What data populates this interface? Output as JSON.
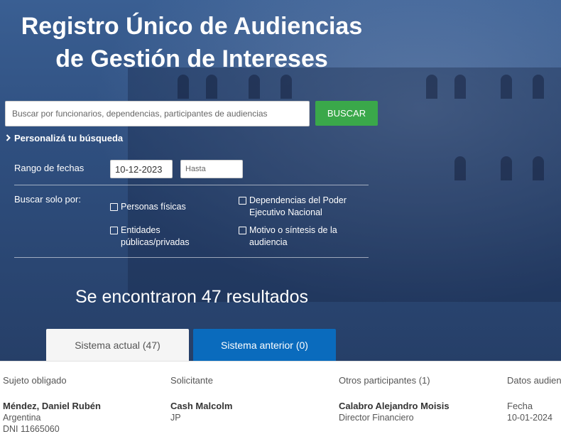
{
  "header": {
    "title_line1": "Registro Único de Audiencias",
    "title_line2": "de Gestión de Intereses"
  },
  "search": {
    "placeholder": "Buscar por funcionarios, dependencias, participantes de audiencias",
    "value": "",
    "button_label": "BUSCAR"
  },
  "filters": {
    "toggle_label": "Personalizá tu búsqueda",
    "date_range_label": "Rango de fechas",
    "date_from": "10-12-2023",
    "date_to_placeholder": "Hasta",
    "date_to": "",
    "search_only_label": "Buscar solo por:",
    "options": [
      {
        "label": "Personas físicas",
        "checked": false
      },
      {
        "label": "Entidades públicas/privadas",
        "line1": "Entidades",
        "line2": "públicas/privadas",
        "checked": false
      },
      {
        "label": "Dependencias del Poder Ejecutivo Nacional",
        "line1": "Dependencias del Poder",
        "line2": "Ejecutivo Nacional",
        "checked": false
      },
      {
        "label": "Motivo o síntesis de la audiencia",
        "line1": "Motivo o síntesis de la",
        "line2": "audiencia",
        "checked": false
      }
    ]
  },
  "results": {
    "summary": "Se encontraron 47 resultados",
    "tabs": [
      {
        "label": "Sistema actual (47)",
        "active": true
      },
      {
        "label": "Sistema anterior (0)",
        "active": false
      }
    ]
  },
  "table": {
    "columns": [
      "Sujeto obligado",
      "Solicitante",
      "Otros participantes (1)",
      "Datos audien"
    ],
    "rows": [
      {
        "sujeto": {
          "name": "Méndez, Daniel Rubén",
          "country": "Argentina",
          "doc": "DNI 11665060"
        },
        "solicitante": {
          "name": "Cash Malcolm",
          "detail": "JP"
        },
        "otros": {
          "name": "Calabro Alejandro Moisis",
          "role": "Director Financiero"
        },
        "datos": {
          "label": "Fecha",
          "value": "10-01-2024"
        }
      }
    ]
  },
  "colors": {
    "hero_bg": "#2f4f7f",
    "search_button": "#3aa84a",
    "tab_active_bg": "#f5f5f5",
    "tab_inactive_bg": "#0a6bbd"
  }
}
